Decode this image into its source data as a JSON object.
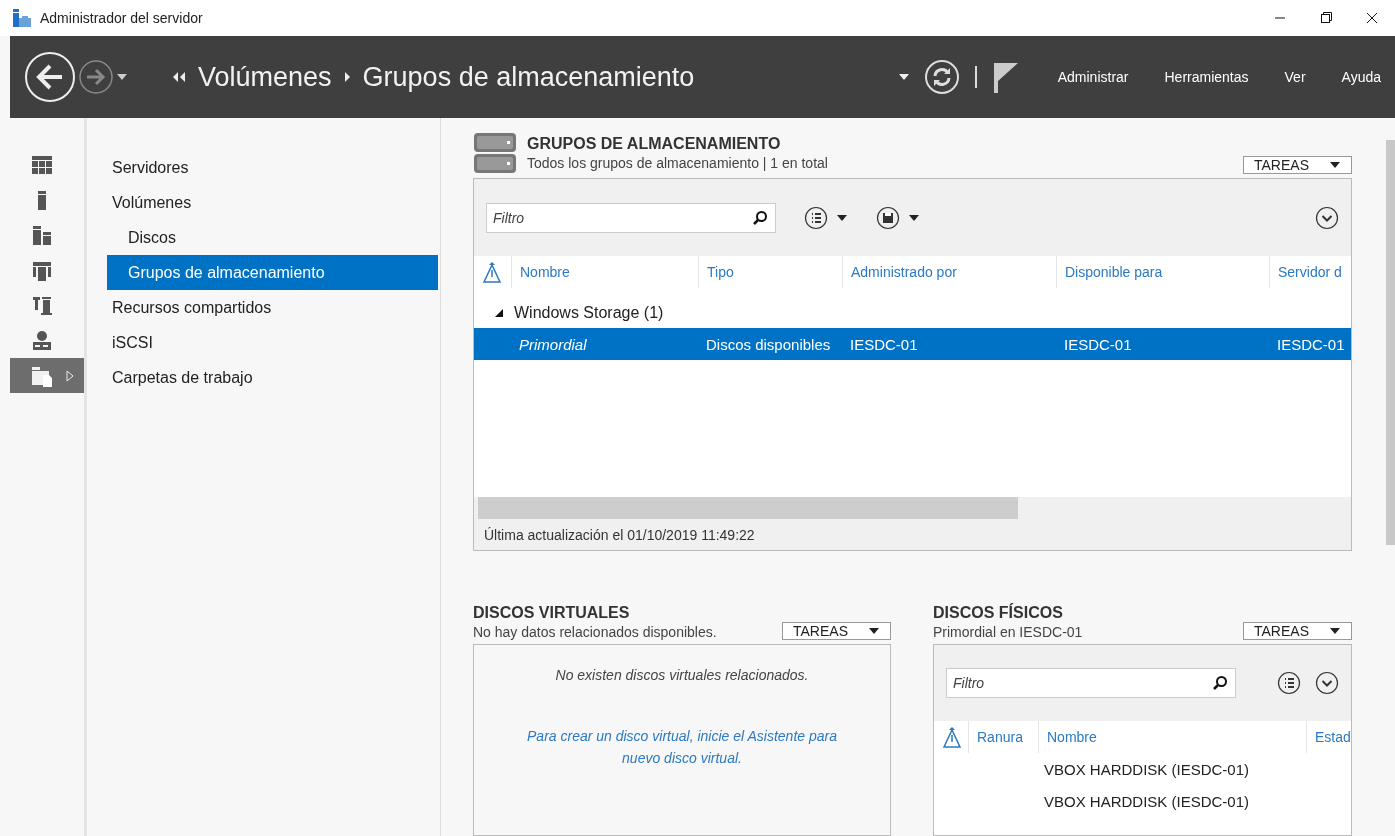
{
  "window": {
    "title": "Administrador del servidor"
  },
  "header": {
    "breadcrumb": [
      "Volúmenes",
      "Grupos de almacenamiento"
    ],
    "menu": [
      "Administrar",
      "Herramientas",
      "Ver",
      "Ayuda"
    ]
  },
  "rail": [
    {
      "kind": "grid",
      "selected": false
    },
    {
      "kind": "tower",
      "selected": false
    },
    {
      "kind": "blocks",
      "selected": false
    },
    {
      "kind": "frame",
      "selected": false
    },
    {
      "kind": "tools",
      "selected": false
    },
    {
      "kind": "network",
      "selected": false
    },
    {
      "kind": "folders",
      "selected": true
    }
  ],
  "nav": [
    {
      "label": "Servidores",
      "selected": false
    },
    {
      "label": "Volúmenes",
      "selected": false,
      "children": [
        {
          "label": "Discos",
          "selected": false
        },
        {
          "label": "Grupos de almacenamiento",
          "selected": true
        }
      ]
    },
    {
      "label": "Recursos compartidos",
      "selected": false
    },
    {
      "label": "iSCSI",
      "selected": false
    },
    {
      "label": "Carpetas de trabajo",
      "selected": false
    }
  ],
  "pools": {
    "title": "GRUPOS DE ALMACENAMIENTO",
    "subtitle": "Todos los grupos de almacenamiento | 1 en total",
    "tasks": "TAREAS",
    "filter": {
      "placeholder": "Filtro"
    },
    "columns": [
      "Nombre",
      "Tipo",
      "Administrado por",
      "Disponible para",
      "Servidor d"
    ],
    "groups": [
      {
        "label": "Windows Storage (1)",
        "expanded": true,
        "rows": [
          {
            "cells": [
              "Primordial",
              "Discos disponibles",
              "IESDC-01",
              "IESDC-01",
              "IESDC-01"
            ],
            "selected": true
          }
        ]
      }
    ],
    "status": "Última actualización el 01/10/2019 11:49:22"
  },
  "virtual_disks": {
    "title": "DISCOS VIRTUALES",
    "subtitle": "No hay datos relacionados disponibles.",
    "tasks": "TAREAS",
    "message": "No existen discos virtuales relacionados.",
    "link": "Para crear un disco virtual, inicie el Asistente para nuevo disco virtual."
  },
  "physical_disks": {
    "title": "DISCOS FÍSICOS",
    "subtitle": "Primordial en IESDC-01",
    "tasks": "TAREAS",
    "filter": {
      "placeholder": "Filtro"
    },
    "columns": [
      "Ranura",
      "Nombre",
      "Estad"
    ],
    "rows": [
      {
        "name": "VBOX HARDDISK (IESDC-01)"
      },
      {
        "name": "VBOX HARDDISK (IESDC-01)"
      }
    ]
  }
}
